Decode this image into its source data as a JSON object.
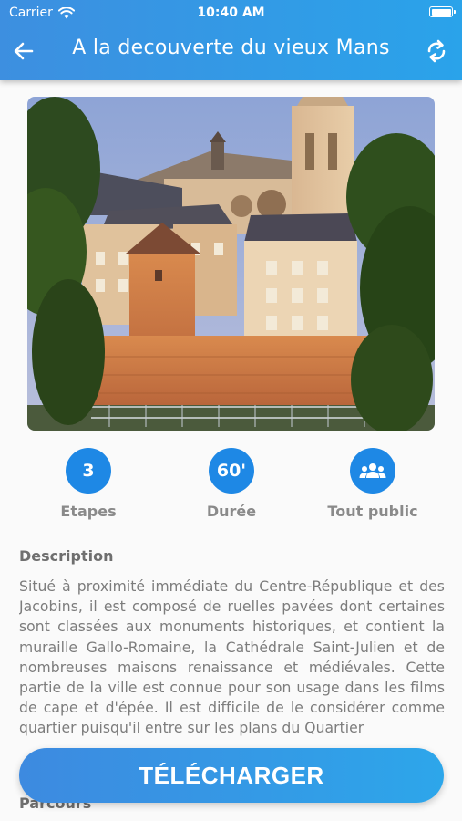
{
  "status_bar": {
    "carrier": "Carrier",
    "time": "10:40 AM"
  },
  "header": {
    "title": "A la decouverte du vieux Mans"
  },
  "stats": [
    {
      "value": "3",
      "label": "Etapes"
    },
    {
      "value": "60'",
      "label": "Durée"
    },
    {
      "value": "",
      "icon": "group-icon",
      "label": "Tout public"
    }
  ],
  "description": {
    "title": "Description",
    "text": "Situé à proximité immédiate du Centre-République et des Jacobins, il est composé de ruelles pavées dont certaines sont classées aux monuments historiques, et contient la muraille Gallo-Romaine, la Cathédrale Saint-Julien et de nombreuses maisons renaissance et médiévales. Cette partie de la ville est connue pour son usage dans les films de cape et d'épée. Il est difficile de le considérer comme quartier puisqu'il entre sur les plans du Quartier"
  },
  "parcours": {
    "title": "Parcours"
  },
  "download_button": {
    "label": "TÉLÉCHARGER"
  },
  "colors": {
    "primary": "#1e88e5",
    "header_start": "#3d8fe0",
    "header_end": "#2aa3ea"
  }
}
